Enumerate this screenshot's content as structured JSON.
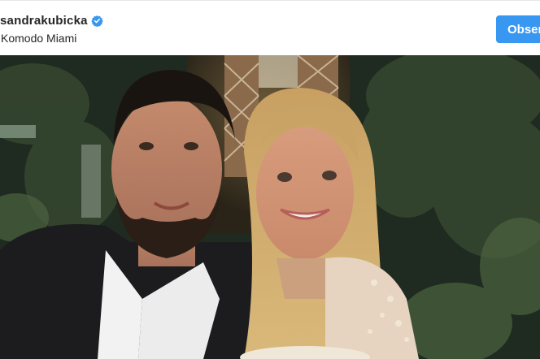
{
  "post": {
    "username": "sandrakubicka",
    "location": "Komodo Miami",
    "follow_label": "Obserwuj"
  },
  "icons": {
    "verified": "verified-badge-icon"
  },
  "colors": {
    "accent": "#3897f0",
    "text": "#262626",
    "verified": "#3897f0"
  }
}
